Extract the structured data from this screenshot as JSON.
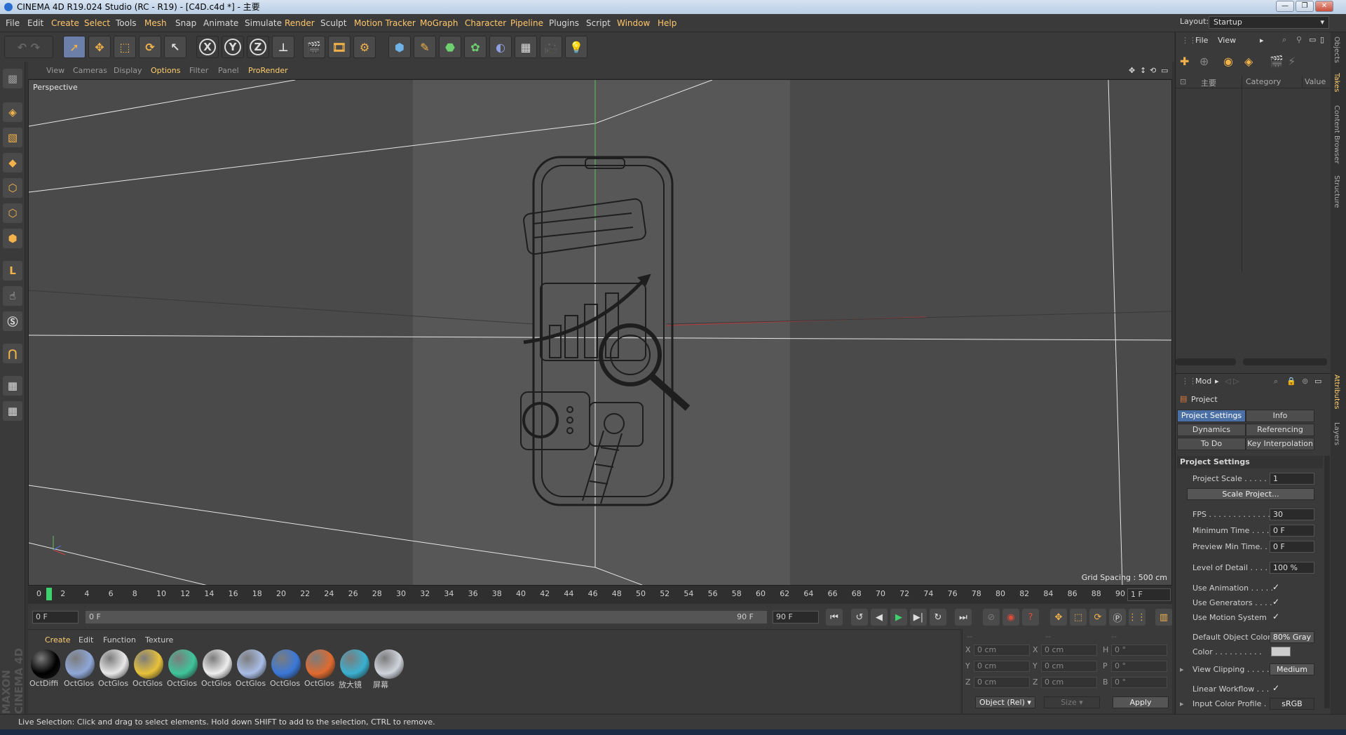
{
  "window": {
    "title": "CINEMA 4D R19.024 Studio (RC - R19) - [C4D.c4d *] - 主要"
  },
  "menu": [
    "File",
    "Edit",
    "Create",
    "Select",
    "Tools",
    "Mesh",
    "Snap",
    "Animate",
    "Simulate",
    "Render",
    "Sculpt",
    "Motion Tracker",
    "MoGraph",
    "Character",
    "Pipeline",
    "Plugins",
    "Script",
    "Window",
    "Help"
  ],
  "layout": {
    "label": "Layout:",
    "value": "Startup"
  },
  "toolbar": {
    "x": "X",
    "y": "Y",
    "z": "Z"
  },
  "viewport_menu": [
    "View",
    "Cameras",
    "Display",
    "Options",
    "Filter",
    "Panel",
    "ProRender"
  ],
  "viewport": {
    "name": "Perspective",
    "grid_spacing": "Grid Spacing : 500 cm"
  },
  "timeline": {
    "ticks": [
      "0",
      "2",
      "4",
      "6",
      "8",
      "10",
      "12",
      "14",
      "16",
      "18",
      "20",
      "22",
      "24",
      "26",
      "28",
      "30",
      "32",
      "34",
      "36",
      "38",
      "40",
      "42",
      "44",
      "46",
      "48",
      "50",
      "52",
      "54",
      "56",
      "58",
      "60",
      "62",
      "64",
      "66",
      "68",
      "70",
      "72",
      "74",
      "76",
      "78",
      "80",
      "82",
      "84",
      "86",
      "88",
      "90"
    ],
    "current": "1 F",
    "start": "0 F",
    "slider_start": "0 F",
    "slider_end": "90 F",
    "end": "90 F"
  },
  "materials": {
    "menu": [
      "Create",
      "Edit",
      "Function",
      "Texture"
    ],
    "items": [
      {
        "label": "OctDiffi",
        "color": "#000000"
      },
      {
        "label": "OctGlos",
        "color": "#8fa7d8"
      },
      {
        "label": "OctGlos",
        "color": "#e8e8e8"
      },
      {
        "label": "OctGlos",
        "color": "#e8c23a"
      },
      {
        "label": "OctGlos",
        "color": "#3fc49a"
      },
      {
        "label": "OctGlos",
        "color": "#eeeeee"
      },
      {
        "label": "OctGlos",
        "color": "#a9bde6"
      },
      {
        "label": "OctGlos",
        "color": "#3a78d8"
      },
      {
        "label": "OctGlos",
        "color": "#e06a2e"
      },
      {
        "label": "放大镜",
        "color": "#3ab0d0"
      },
      {
        "label": "屏幕",
        "color": "#d0d4dc"
      }
    ],
    "brand": "MAXON CINEMA 4D"
  },
  "coords": {
    "dash": "--",
    "rows": [
      {
        "a": "X",
        "av": "0 cm",
        "b": "X",
        "bv": "0 cm",
        "c": "H",
        "cv": "0 °"
      },
      {
        "a": "Y",
        "av": "0 cm",
        "b": "Y",
        "bv": "0 cm",
        "c": "P",
        "cv": "0 °"
      },
      {
        "a": "Z",
        "av": "0 cm",
        "b": "Z",
        "bv": "0 cm",
        "c": "B",
        "cv": "0 °"
      }
    ],
    "mode": "Object (Rel)",
    "size": "Size",
    "apply": "Apply"
  },
  "objects": {
    "menu": [
      "File",
      "View"
    ],
    "col_layer": "主要",
    "col_category": "Category",
    "col_value": "Value"
  },
  "attributes": {
    "mode": "Mod",
    "object": "Project",
    "tabs": [
      "Project Settings",
      "Info",
      "Dynamics",
      "Referencing",
      "To Do",
      "Key Interpolation"
    ],
    "section": "Project Settings",
    "rows": [
      {
        "label": "Project Scale . . . . . .",
        "value": "1"
      },
      {
        "label": "FPS . . . . . . . . . . . . . .",
        "value": "30"
      },
      {
        "label": "Minimum Time . . . .",
        "value": "0 F"
      },
      {
        "label": "Preview Min Time. . .",
        "value": "0 F"
      },
      {
        "label": "Level of Detail . . . . .",
        "value": "100 %"
      }
    ],
    "scale_button": "Scale Project...",
    "checks": [
      {
        "label": "Use Animation . . . . .",
        "value": "✓"
      },
      {
        "label": "Use Generators . . . .",
        "value": "✓"
      },
      {
        "label": "Use Motion System",
        "value": "✓"
      }
    ],
    "default_color_label": "Default Object Color",
    "default_color_value": "80% Gray",
    "color_label": "Color . . . . . . . . . .",
    "view_clipping_label": "View Clipping . . . . . .",
    "view_clipping_value": "Medium",
    "linear_workflow_label": "Linear Workflow . . .",
    "linear_workflow_value": "✓",
    "input_profile_label": "Input Color Profile . .",
    "input_profile_value": "sRGB"
  },
  "side_tabs": [
    "Objects",
    "Takes",
    "Content Browser",
    "Structure",
    "Attributes",
    "Layers"
  ],
  "status": "Live Selection: Click and drag to select elements. Hold down SHIFT to add to the selection, CTRL to remove."
}
